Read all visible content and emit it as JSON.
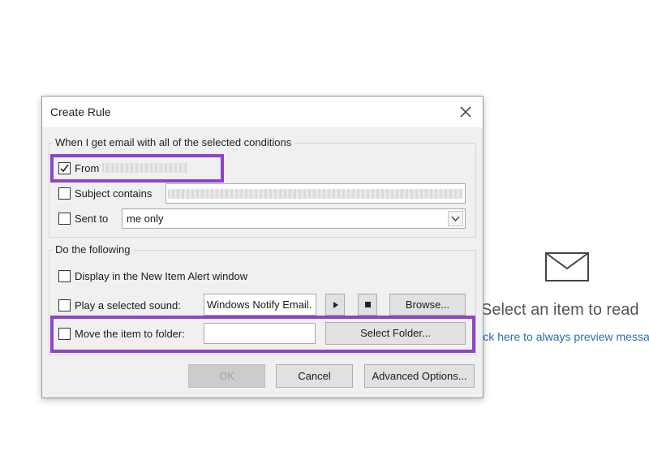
{
  "dialog": {
    "title": "Create Rule",
    "conditions_group": "When I get email with all of the selected conditions",
    "from_label": "From",
    "subject_label": "Subject contains",
    "sent_to_label": "Sent to",
    "sent_to_value": "me only",
    "actions_group": "Do the following",
    "display_alert_label": "Display in the New Item Alert window",
    "play_sound_label": "Play a selected sound:",
    "sound_value": "Windows Notify Email.",
    "browse_label": "Browse...",
    "move_label": "Move the item to folder:",
    "folder_value": "",
    "select_folder_label": "Select Folder...",
    "ok_label": "OK",
    "cancel_label": "Cancel",
    "advanced_label": "Advanced Options..."
  },
  "background": {
    "empty_title": "Select an item to read",
    "preview_link": "Click here to always preview messages"
  },
  "colors": {
    "highlight": "#8e44c7",
    "link": "#2b6cb0"
  }
}
